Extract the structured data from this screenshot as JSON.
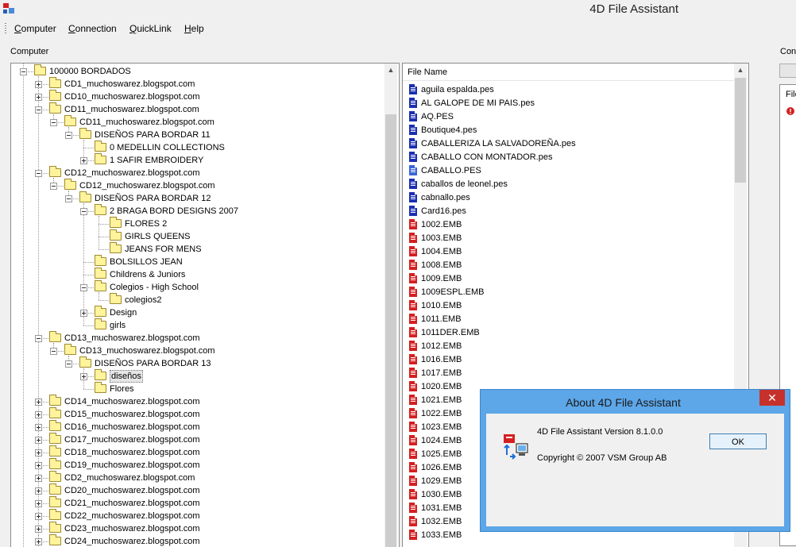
{
  "window": {
    "title": "4D File Assistant"
  },
  "menu": [
    {
      "label": "Computer",
      "u": "C",
      "rest": "omputer"
    },
    {
      "label": "Connection",
      "u": "C",
      "rest": "onnection"
    },
    {
      "label": "QuickLink",
      "u": "Q",
      "rest": "uickLink"
    },
    {
      "label": "Help",
      "u": "H",
      "rest": "elp"
    }
  ],
  "computer_label": "Computer",
  "connection_label_fragment": "Con",
  "tree": [
    {
      "label": "100000 BORDADOS",
      "depth": 0,
      "exp": "minus"
    },
    {
      "label": "CD1_muchoswarez.blogspot.com",
      "depth": 1,
      "exp": "plus"
    },
    {
      "label": "CD10_muchoswarez.blogspot.com",
      "depth": 1,
      "exp": "plus"
    },
    {
      "label": "CD11_muchoswarez.blogspot.com",
      "depth": 1,
      "exp": "minus"
    },
    {
      "label": "CD11_muchoswarez.blogspot.com",
      "depth": 2,
      "exp": "minus"
    },
    {
      "label": "DISEÑOS PARA BORDAR 11",
      "depth": 3,
      "exp": "minus"
    },
    {
      "label": "0 MEDELLIN COLLECTIONS",
      "depth": 4,
      "exp": "none"
    },
    {
      "label": "1 SAFIR  EMBROIDERY",
      "depth": 4,
      "exp": "plus"
    },
    {
      "label": "CD12_muchoswarez.blogspot.com",
      "depth": 1,
      "exp": "minus"
    },
    {
      "label": "CD12_muchoswarez.blogspot.com",
      "depth": 2,
      "exp": "minus"
    },
    {
      "label": "DISEÑOS PARA BORDAR 12",
      "depth": 3,
      "exp": "minus"
    },
    {
      "label": "2 BRAGA BORD DESIGNS 2007",
      "depth": 4,
      "exp": "minus"
    },
    {
      "label": "FLORES 2",
      "depth": 5,
      "exp": "none"
    },
    {
      "label": "GIRLS QUEENS",
      "depth": 5,
      "exp": "none"
    },
    {
      "label": "JEANS FOR MENS",
      "depth": 5,
      "exp": "none"
    },
    {
      "label": "BOLSILLOS JEAN",
      "depth": 4,
      "exp": "none"
    },
    {
      "label": "Childrens & Juniors",
      "depth": 4,
      "exp": "none"
    },
    {
      "label": "Colegios - High School",
      "depth": 4,
      "exp": "minus"
    },
    {
      "label": "colegios2",
      "depth": 5,
      "exp": "none"
    },
    {
      "label": "Design",
      "depth": 4,
      "exp": "plus"
    },
    {
      "label": "girls",
      "depth": 4,
      "exp": "none"
    },
    {
      "label": "CD13_muchoswarez.blogspot.com",
      "depth": 1,
      "exp": "minus"
    },
    {
      "label": "CD13_muchoswarez.blogspot.com",
      "depth": 2,
      "exp": "minus"
    },
    {
      "label": "DISEÑOS PARA BORDAR 13",
      "depth": 3,
      "exp": "minus"
    },
    {
      "label": "diseños",
      "depth": 4,
      "exp": "plus",
      "selected": true
    },
    {
      "label": "Flores",
      "depth": 4,
      "exp": "none"
    },
    {
      "label": "CD14_muchoswarez.blogspot.com",
      "depth": 1,
      "exp": "plus"
    },
    {
      "label": "CD15_muchoswarez.blogspot.com",
      "depth": 1,
      "exp": "plus"
    },
    {
      "label": "CD16_muchoswarez.blogspot.com",
      "depth": 1,
      "exp": "plus"
    },
    {
      "label": "CD17_muchoswarez.blogspot.com",
      "depth": 1,
      "exp": "plus"
    },
    {
      "label": "CD18_muchoswarez.blogspot.com",
      "depth": 1,
      "exp": "plus"
    },
    {
      "label": "CD19_muchoswarez.blogspot.com",
      "depth": 1,
      "exp": "plus"
    },
    {
      "label": "CD2_muchoswarez.blogspot.com",
      "depth": 1,
      "exp": "plus"
    },
    {
      "label": "CD20_muchoswarez.blogspot.com",
      "depth": 1,
      "exp": "plus"
    },
    {
      "label": "CD21_muchoswarez.blogspot.com",
      "depth": 1,
      "exp": "plus"
    },
    {
      "label": "CD22_muchoswarez.blogspot.com",
      "depth": 1,
      "exp": "plus"
    },
    {
      "label": "CD23_muchoswarez.blogspot.com",
      "depth": 1,
      "exp": "plus"
    },
    {
      "label": "CD24_muchoswarez.blogspot.com",
      "depth": 1,
      "exp": "plus"
    }
  ],
  "file_list": {
    "column_header": "File Name",
    "files": [
      {
        "name": "aguila espalda.pes",
        "icon": "pes"
      },
      {
        "name": "AL GALOPE DE MI PAIS.pes",
        "icon": "pes"
      },
      {
        "name": "AQ.PES",
        "icon": "pes"
      },
      {
        "name": "Boutique4.pes",
        "icon": "pes"
      },
      {
        "name": "CABALLERIZA LA SALVADOREÑA.pes",
        "icon": "pes"
      },
      {
        "name": "CABALLO CON MONTADOR.pes",
        "icon": "pes"
      },
      {
        "name": "CABALLO.PES",
        "icon": "pes2"
      },
      {
        "name": "caballos de leonel.pes",
        "icon": "pes"
      },
      {
        "name": "cabnallo.pes",
        "icon": "pes"
      },
      {
        "name": "Card16.pes",
        "icon": "pes"
      },
      {
        "name": "1002.EMB",
        "icon": "emb"
      },
      {
        "name": "1003.EMB",
        "icon": "emb"
      },
      {
        "name": "1004.EMB",
        "icon": "emb"
      },
      {
        "name": "1008.EMB",
        "icon": "emb"
      },
      {
        "name": "1009.EMB",
        "icon": "emb"
      },
      {
        "name": "1009ESPL.EMB",
        "icon": "emb"
      },
      {
        "name": "1010.EMB",
        "icon": "emb"
      },
      {
        "name": "1011.EMB",
        "icon": "emb"
      },
      {
        "name": "1011DER.EMB",
        "icon": "emb"
      },
      {
        "name": "1012.EMB",
        "icon": "emb"
      },
      {
        "name": "1016.EMB",
        "icon": "emb"
      },
      {
        "name": "1017.EMB",
        "icon": "emb"
      },
      {
        "name": "1020.EMB",
        "icon": "emb"
      },
      {
        "name": "1021.EMB",
        "icon": "emb"
      },
      {
        "name": "1022.EMB",
        "icon": "emb"
      },
      {
        "name": "1023.EMB",
        "icon": "emb"
      },
      {
        "name": "1024.EMB",
        "icon": "emb"
      },
      {
        "name": "1025.EMB",
        "icon": "emb"
      },
      {
        "name": "1026.EMB",
        "icon": "emb"
      },
      {
        "name": "1029.EMB",
        "icon": "emb"
      },
      {
        "name": "1030.EMB",
        "icon": "emb"
      },
      {
        "name": "1031.EMB",
        "icon": "emb"
      },
      {
        "name": "1032.EMB",
        "icon": "emb"
      },
      {
        "name": "1033.EMB",
        "icon": "emb"
      }
    ]
  },
  "right_pane_fragment": {
    "header": "File"
  },
  "about_dialog": {
    "title": "About 4D File Assistant",
    "close_glyph": "✕",
    "version_text": "4D File Assistant Version 8.1.0.0",
    "copyright_text": "Copyright © 2007 VSM Group AB",
    "ok_label": "OK"
  },
  "colors": {
    "dialog_frame": "#5da6e8",
    "close_button": "#c7312b",
    "pes_icon": "#1b2fb0",
    "emb_icon": "#d42020"
  }
}
